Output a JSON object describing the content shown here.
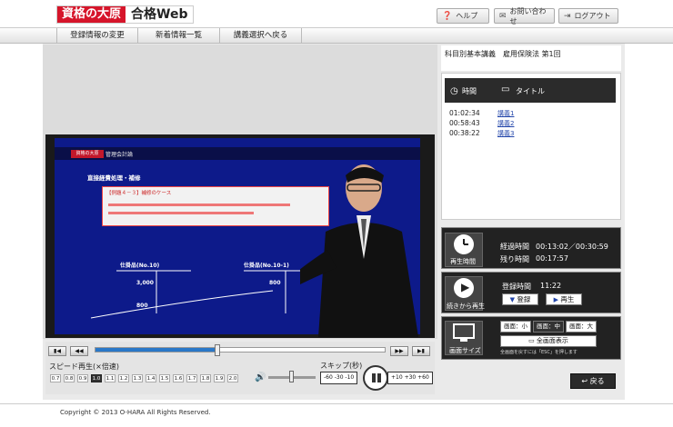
{
  "header": {
    "logo_school": "資格の大原",
    "logo_web": "合格Web",
    "help": "ヘルプ",
    "contact": "お問い合わせ",
    "logout": "ログアウト"
  },
  "nav": [
    "登録情報の変更",
    "新着情報一覧",
    "講義選択へ戻る"
  ],
  "slide": {
    "logo": "資格の大原",
    "title": "管理会計論",
    "heading": "直接経費処理・補修",
    "box_title": "【例題４－３】補修のケース",
    "label1": "仕掛品(No.10)",
    "label2": "仕掛品(No.10-1)",
    "n1": "3,000",
    "n2": "800",
    "n3": "800"
  },
  "player": {
    "speed_label": "スピード再生(×倍速)",
    "speeds": [
      "0.7",
      "0.8",
      "0.9",
      "1.0",
      "1.1",
      "1.2",
      "1.3",
      "1.4",
      "1.5",
      "1.6",
      "1.7",
      "1.8",
      "1.9",
      "2.0"
    ],
    "speed_selected": "1.0",
    "skip_label": "スキップ(秒)",
    "skip_back": "-60 -30 -10",
    "skip_fwd": "+10 +30 +60",
    "progress": 0.42
  },
  "course": {
    "title": "科目別基本講義　雇用保険法 第1回"
  },
  "chapters": {
    "col_time": "時間",
    "col_title": "タイトル",
    "items": [
      {
        "time": "01:02:34",
        "title": "講義1"
      },
      {
        "time": "00:58:43",
        "title": "講義2"
      },
      {
        "time": "00:38:22",
        "title": "講義3"
      }
    ]
  },
  "playtime": {
    "label": "再生時間",
    "elapsed_label": "経過時間",
    "elapsed": "00:13:02／00:30:59",
    "remaining_label": "残り時間",
    "remaining": "00:17:57"
  },
  "resume": {
    "label": "続きから再生",
    "reg_label": "登録時間",
    "reg_time": "11:22",
    "register_btn": "登録",
    "play_btn": "再生"
  },
  "screen": {
    "label": "画面サイズ",
    "small": "画面：小",
    "medium": "画面：中",
    "large": "画面：大",
    "full": "全画面表示",
    "note": "全画面を戻すには「ESC」を押します"
  },
  "back_btn": "戻る",
  "footer": "Copyright © 2013 O-HARA All Rights Reserved."
}
